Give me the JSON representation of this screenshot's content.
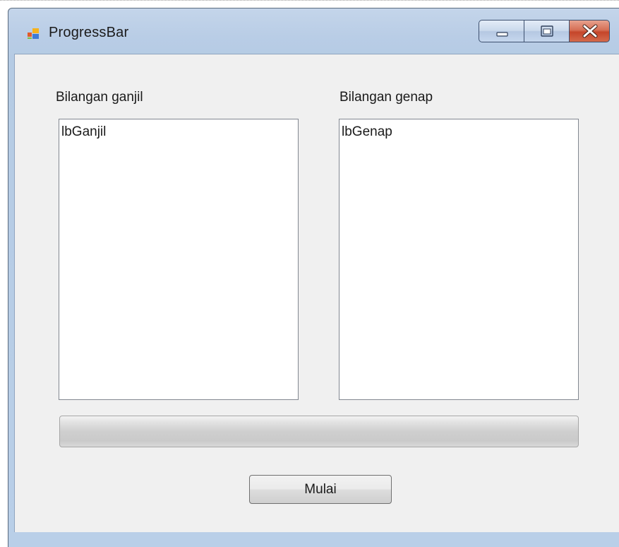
{
  "window": {
    "title": "ProgressBar",
    "icon": "winforms-app-icon",
    "caption_buttons": [
      "minimize-icon",
      "maximize-icon",
      "close-icon"
    ],
    "close_button_color": "#c5452a",
    "frame_color": "#b9cde6"
  },
  "form": {
    "odd_label": "Bilangan ganjil",
    "even_label": "Bilangan genap",
    "odd_list": {
      "items": [
        "lbGanjil"
      ]
    },
    "even_list": {
      "items": [
        "lbGenap"
      ]
    },
    "progress": {
      "value": 0
    },
    "start_button_label": "Mulai"
  }
}
